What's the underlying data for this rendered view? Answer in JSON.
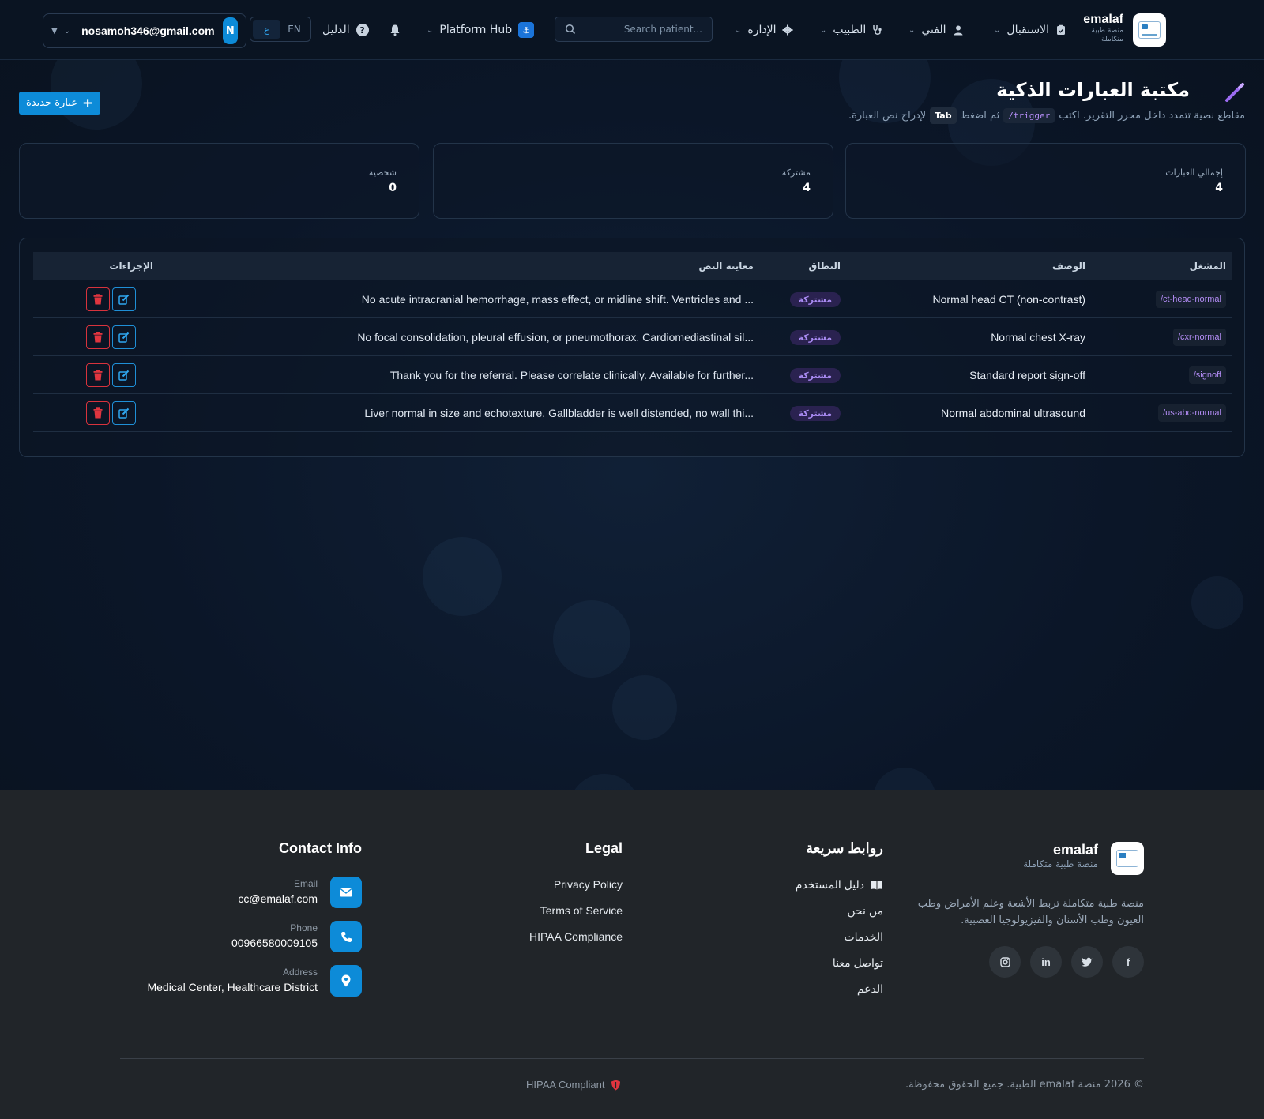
{
  "header": {
    "brand_name": "emalaf",
    "brand_sub": "منصة طبية متكاملة",
    "nav": [
      {
        "label": "الاستقبال"
      },
      {
        "label": "الفني"
      },
      {
        "label": "الطبيب"
      },
      {
        "label": "الإدارة"
      }
    ],
    "search_placeholder": "Search patient...",
    "platform_hub": "Platform Hub",
    "guide": "الدليل",
    "lang_en": "EN",
    "lang_ar": "ع",
    "user_email": "nosamoh346@gmail.com",
    "user_initial": "N"
  },
  "page": {
    "title": "مكتبة العبارات الذكية",
    "subtitle_part1": "مقاطع نصية تتمدد داخل محرر التقرير. اكتب",
    "subtitle_code": "/trigger",
    "subtitle_part2": "ثم اضغط",
    "subtitle_key": "Tab",
    "subtitle_part3": "لإدراج نص العبارة.",
    "new_button": "عبارة جديدة"
  },
  "stats": [
    {
      "label": "إجمالي العبارات",
      "value": "4"
    },
    {
      "label": "مشتركة",
      "value": "4"
    },
    {
      "label": "شخصية",
      "value": "0"
    }
  ],
  "table": {
    "headers": {
      "trigger": "المشغل",
      "description": "الوصف",
      "scope": "النطاق",
      "preview": "معاينة النص",
      "actions": "الإجراءات"
    },
    "rows": [
      {
        "trigger": "/ct-head-normal",
        "description": "Normal head CT (non-contrast)",
        "scope": "مشتركة",
        "preview": "No acute intracranial hemorrhage, mass effect, or midline shift. Ventricles and ..."
      },
      {
        "trigger": "/cxr-normal",
        "description": "Normal chest X-ray",
        "scope": "مشتركة",
        "preview": "No focal consolidation, pleural effusion, or pneumothorax. Cardiomediastinal sil..."
      },
      {
        "trigger": "/signoff",
        "description": "Standard report sign-off",
        "scope": "مشتركة",
        "preview": "Thank you for the referral. Please correlate clinically. Available for further..."
      },
      {
        "trigger": "/us-abd-normal",
        "description": "Normal abdominal ultrasound",
        "scope": "مشتركة",
        "preview": "Liver normal in size and echotexture. Gallbladder is well distended, no wall thi..."
      }
    ]
  },
  "footer": {
    "brand_name": "emalaf",
    "brand_sub": "منصة طبية متكاملة",
    "about": "منصة طبية متكاملة تربط الأشعة وعلم الأمراض وطب العيون وطب الأسنان والفيزيولوجيا العصبية.",
    "quick_links_title": "روابط سريعة",
    "quick_links": [
      "دليل المستخدم",
      "من نحن",
      "الخدمات",
      "تواصل معنا",
      "الدعم"
    ],
    "legal_title": "Legal",
    "legal_links": [
      "Privacy Policy",
      "Terms of Service",
      "HIPAA Compliance"
    ],
    "contact_title": "Contact Info",
    "contact": {
      "email_label": "Email",
      "email": "cc@emalaf.com",
      "phone_label": "Phone",
      "phone": "00966580009105",
      "address_label": "Address",
      "address": "Medical Center, Healthcare District"
    },
    "social": [
      "facebook-icon",
      "twitter-icon",
      "linkedin-icon",
      "instagram-icon"
    ],
    "copyright": "© 2026 منصة emalaf الطبية. جميع الحقوق محفوظة.",
    "hipaa": "HIPAA Compliant"
  },
  "colors": {
    "accent": "#0d8bd8",
    "danger": "#d8333d",
    "purple": "#b38cf5",
    "background": "#0b1526",
    "footer": "#212529"
  }
}
